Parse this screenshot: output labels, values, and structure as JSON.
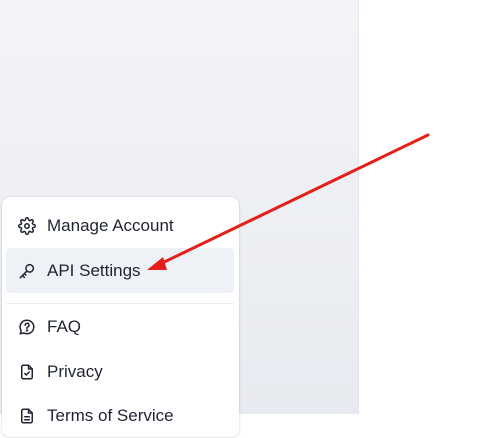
{
  "menu": {
    "items": [
      {
        "label": "Manage Account",
        "icon": "gear-icon"
      },
      {
        "label": "API Settings",
        "icon": "key-icon",
        "active": true
      },
      {
        "label": "FAQ",
        "icon": "help-bubble-icon"
      },
      {
        "label": "Privacy",
        "icon": "document-check-icon"
      },
      {
        "label": "Terms of Service",
        "icon": "document-icon"
      }
    ]
  },
  "colors": {
    "annotation_arrow": "#e3201b",
    "active_item_bg": "#eef1f6",
    "text": "#1f2430"
  }
}
